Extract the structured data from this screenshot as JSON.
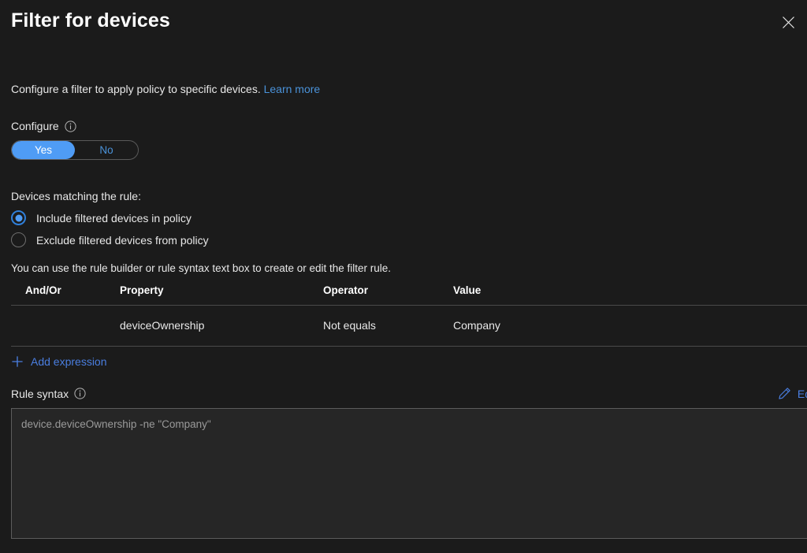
{
  "panel": {
    "title": "Filter for devices",
    "close_icon": "close-icon",
    "intro": {
      "text": "Configure a filter to apply policy to specific devices.",
      "link_label": "Learn more"
    }
  },
  "configure": {
    "label": "Configure",
    "info_icon": "info-icon",
    "toggle": {
      "options": [
        "Yes",
        "No"
      ],
      "selected": "Yes",
      "selected_bg": "#4f9cf5",
      "unselected_text": "#4a92d9"
    }
  },
  "devices_matching": {
    "label": "Devices matching the rule:",
    "options": [
      {
        "label": "Include filtered devices in policy",
        "selected": true
      },
      {
        "label": "Exclude filtered devices from policy",
        "selected": false
      }
    ],
    "accent": "#4f9cf5"
  },
  "rule_builder": {
    "helper_text": "You can use the rule builder or rule syntax text box to create or edit the filter rule.",
    "columns": [
      "And/Or",
      "Property",
      "Operator",
      "Value"
    ],
    "rows": [
      {
        "andor": "",
        "property": "deviceOwnership",
        "operator": "Not equals",
        "value": "Company",
        "delete_icon": "trash-icon"
      }
    ],
    "add_expression": {
      "label": "Add expression",
      "icon": "plus-icon",
      "color": "#4a7ee0"
    }
  },
  "rule_syntax": {
    "label": "Rule syntax",
    "info_icon": "info-icon",
    "edit": {
      "label": "Edit",
      "icon": "pencil-icon",
      "color": "#4a7ee0"
    },
    "value": "device.deviceOwnership -ne \"Company\"",
    "placeholder": "device.deviceOwnership -ne \"Company\""
  }
}
